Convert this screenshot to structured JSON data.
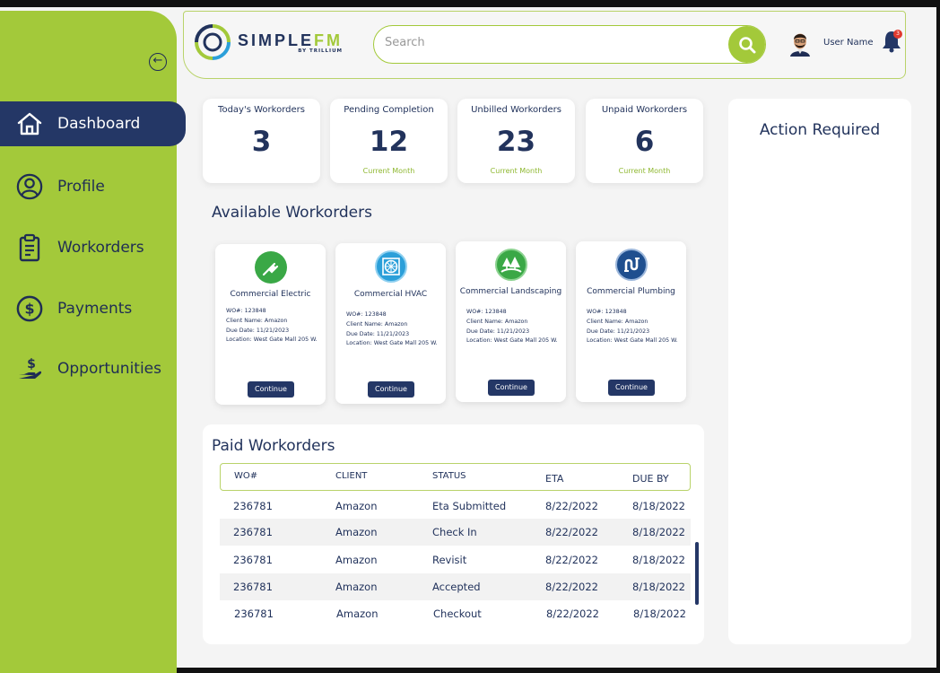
{
  "app": {
    "logo_main": "SIMPLE",
    "logo_accent": "FM",
    "logo_sub": "BY TRILLIUM"
  },
  "sidebar": {
    "items": [
      {
        "label": "Dashboard",
        "icon": "home-icon",
        "active": true
      },
      {
        "label": "Profile",
        "icon": "user-circle-icon",
        "active": false
      },
      {
        "label": "Workorders",
        "icon": "clipboard-icon",
        "active": false
      },
      {
        "label": "Payments",
        "icon": "dollar-circle-icon",
        "active": false
      },
      {
        "label": "Opportunities",
        "icon": "hand-dollar-icon",
        "active": false
      }
    ]
  },
  "header": {
    "search_placeholder": "Search",
    "user_name": "User Name",
    "notification_count": "3"
  },
  "stats": [
    {
      "title": "Today's Workorders",
      "value": "3",
      "sub": ""
    },
    {
      "title": "Pending Completion",
      "value": "12",
      "sub": "Current Month"
    },
    {
      "title": "Unbilled Workorders",
      "value": "23",
      "sub": "Current Month"
    },
    {
      "title": "Unpaid Workorders",
      "value": "6",
      "sub": "Current Month"
    }
  ],
  "available": {
    "title": "Available Workorders",
    "cards": [
      {
        "title": "Commercial Electric",
        "icon": "plug-icon",
        "color": "#3aa846",
        "wo": "WO#: 123848",
        "client": "Client Name: Amazon",
        "due": "Due Date: 11/21/2023",
        "location": "Location: West Gate Mall 205 W.",
        "button": "Continue"
      },
      {
        "title": "Commercial HVAC",
        "icon": "fan-icon",
        "color": "#2b9fd9",
        "wo": "WO#: 123848",
        "client": "Client Name: Amazon",
        "due": "Due Date: 11/21/2023",
        "location": "Location: West Gate Mall 205 W.",
        "button": "Continue"
      },
      {
        "title": "Commercial Landscaping",
        "icon": "trees-icon",
        "color": "#3aa846",
        "wo": "WO#: 123848",
        "client": "Client Name: Amazon",
        "due": "Due Date: 11/21/2023",
        "location": "Location: West Gate Mall 205 W.",
        "button": "Continue"
      },
      {
        "title": "Commercial Plumbing",
        "icon": "pipe-icon",
        "color": "#1f4f8f",
        "wo": "WO#: 123848",
        "client": "Client Name: Amazon",
        "due": "Due Date: 11/21/2023",
        "location": "Location: West Gate Mall 205 W.",
        "button": "Continue"
      }
    ]
  },
  "paid": {
    "title": "Paid Workorders",
    "columns": [
      "WO#",
      "CLIENT",
      "STATUS",
      "ETA",
      "DUE BY"
    ],
    "rows": [
      [
        "236781",
        "Amazon",
        "Eta Submitted",
        "8/22/2022",
        "8/18/2022"
      ],
      [
        "236781",
        "Amazon",
        "Check In",
        "8/22/2022",
        "8/18/2022"
      ],
      [
        "236781",
        "Amazon",
        "Revisit",
        "8/22/2022",
        "8/18/2022"
      ],
      [
        "236781",
        "Amazon",
        "Accepted",
        "8/22/2022",
        "8/18/2022"
      ],
      [
        "236781",
        "Amazon",
        "Checkout",
        "8/22/2022",
        "8/18/2022"
      ]
    ]
  },
  "action_panel": {
    "title": "Action Required"
  },
  "colors": {
    "brand_green": "#a3c93a",
    "brand_navy": "#243766",
    "badge_red": "#e03a2f"
  }
}
